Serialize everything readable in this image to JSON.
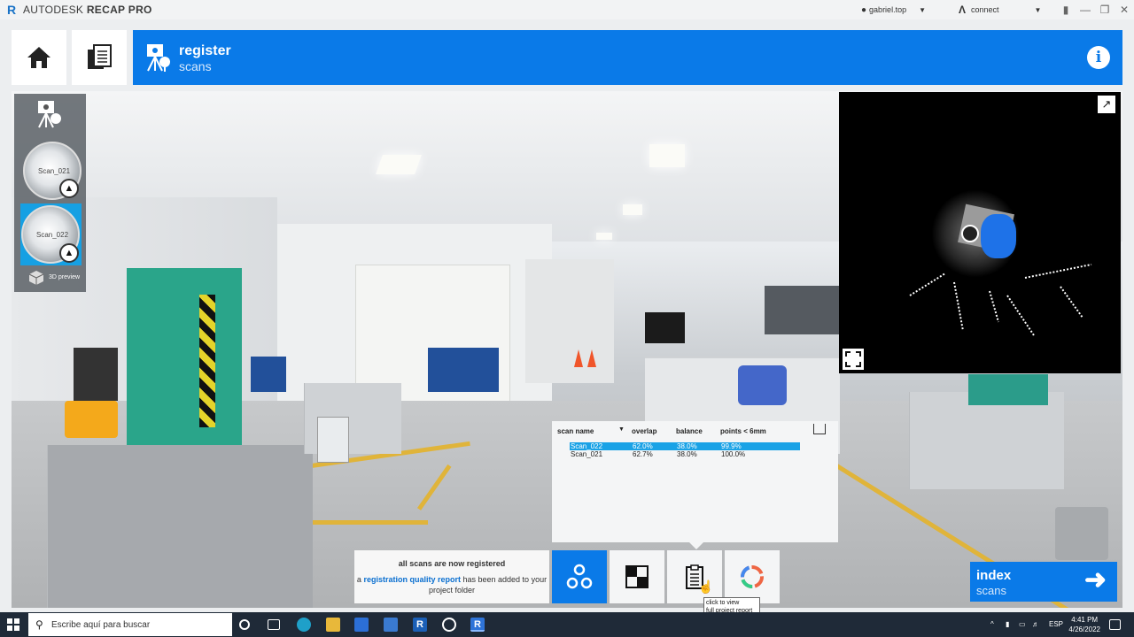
{
  "app": {
    "brand": "AUTODESK",
    "product": "RECAP PRO"
  },
  "titlebar": {
    "user": "gabriel.top",
    "connect": "connect"
  },
  "header": {
    "title": "register",
    "subtitle": "scans",
    "accent": "#0a7ae8"
  },
  "scans_panel": {
    "scans": [
      {
        "label": "Scan_021",
        "selected": false
      },
      {
        "label": "Scan_022",
        "selected": true
      }
    ],
    "preview_label": "3D preview"
  },
  "stats_table": {
    "headers": [
      "scan name",
      "overlap",
      "balance",
      "points < 6mm"
    ],
    "rows": [
      {
        "name": "Scan_022",
        "overlap": "62.0%",
        "balance": "38.0%",
        "points": "99.9%",
        "selected": true
      },
      {
        "name": "Scan_021",
        "overlap": "62.7%",
        "balance": "38.0%",
        "points": "100.0%",
        "selected": false
      }
    ]
  },
  "message": {
    "title": "all scans are now registered",
    "prefix": "a",
    "link": "registration quality report",
    "suffix": "has been added to your project folder"
  },
  "tooltip": {
    "line1": "click to view",
    "line2": "full project report"
  },
  "index_button": {
    "title": "index",
    "subtitle": "scans"
  },
  "taskbar": {
    "search_placeholder": "Escribe aquí para buscar",
    "lang": "ESP",
    "time": "4:41 PM",
    "date": "4/26/2022"
  }
}
